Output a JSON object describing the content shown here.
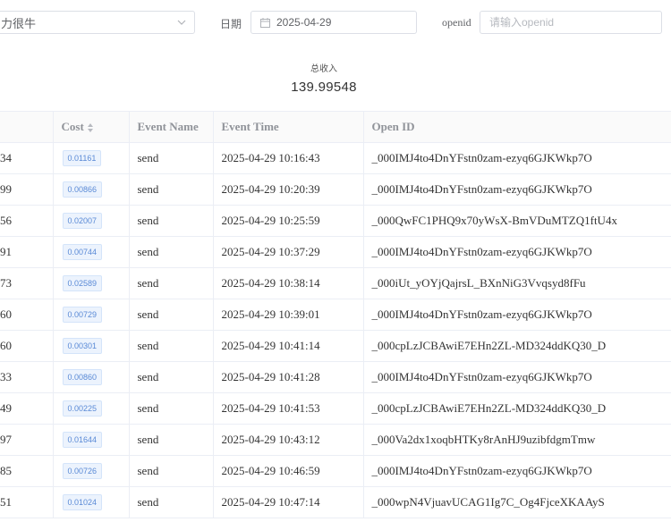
{
  "filters": {
    "app_value": "力很牛",
    "date_label": "日期",
    "date_value": "2025-04-29",
    "openid_label": "openid",
    "openid_placeholder": "请输入openid"
  },
  "summary": {
    "title": "总收入",
    "value": "139.99548"
  },
  "table": {
    "columns": [
      "",
      "Cost",
      "Event Name",
      "Event Time",
      "Open ID"
    ],
    "rows": [
      {
        "c0": "34",
        "cost": "0.01161",
        "event": "send",
        "time": "2025-04-29 10:16:43",
        "openid": "_000IMJ4to4DnYFstn0zam-ezyq6GJKWkp7O"
      },
      {
        "c0": "99",
        "cost": "0.00866",
        "event": "send",
        "time": "2025-04-29 10:20:39",
        "openid": "_000IMJ4to4DnYFstn0zam-ezyq6GJKWkp7O"
      },
      {
        "c0": "56",
        "cost": "0.02007",
        "event": "send",
        "time": "2025-04-29 10:25:59",
        "openid": "_000QwFC1PHQ9x70yWsX-BmVDuMTZQ1ftU4x"
      },
      {
        "c0": "91",
        "cost": "0.00744",
        "event": "send",
        "time": "2025-04-29 10:37:29",
        "openid": "_000IMJ4to4DnYFstn0zam-ezyq6GJKWkp7O"
      },
      {
        "c0": "73",
        "cost": "0.02589",
        "event": "send",
        "time": "2025-04-29 10:38:14",
        "openid": "_000iUt_yOYjQajrsL_BXnNiG3Vvqsyd8fFu"
      },
      {
        "c0": "60",
        "cost": "0.00729",
        "event": "send",
        "time": "2025-04-29 10:39:01",
        "openid": "_000IMJ4to4DnYFstn0zam-ezyq6GJKWkp7O"
      },
      {
        "c0": "60",
        "cost": "0.00301",
        "event": "send",
        "time": "2025-04-29 10:41:14",
        "openid": "_000cpLzJCBAwiE7EHn2ZL-MD324ddKQ30_D"
      },
      {
        "c0": "33",
        "cost": "0.00860",
        "event": "send",
        "time": "2025-04-29 10:41:28",
        "openid": "_000IMJ4to4DnYFstn0zam-ezyq6GJKWkp7O"
      },
      {
        "c0": "49",
        "cost": "0.00225",
        "event": "send",
        "time": "2025-04-29 10:41:53",
        "openid": "_000cpLzJCBAwiE7EHn2ZL-MD324ddKQ30_D"
      },
      {
        "c0": "97",
        "cost": "0.01644",
        "event": "send",
        "time": "2025-04-29 10:43:12",
        "openid": "_000Va2dx1xoqbHTKy8rAnHJ9uzibfdgmTmw"
      },
      {
        "c0": "85",
        "cost": "0.00726",
        "event": "send",
        "time": "2025-04-29 10:46:59",
        "openid": "_000IMJ4to4DnYFstn0zam-ezyq6GJKWkp7O"
      },
      {
        "c0": "51",
        "cost": "0.01024",
        "event": "send",
        "time": "2025-04-29 10:47:14",
        "openid": "_000wpN4VjuavUCAG1Ig7C_Og4FjceXKAAyS"
      }
    ]
  },
  "icons": {
    "select_chevron": "chevron-down-icon",
    "date_icon": "calendar-icon",
    "sort_icon": "sort-icon"
  }
}
